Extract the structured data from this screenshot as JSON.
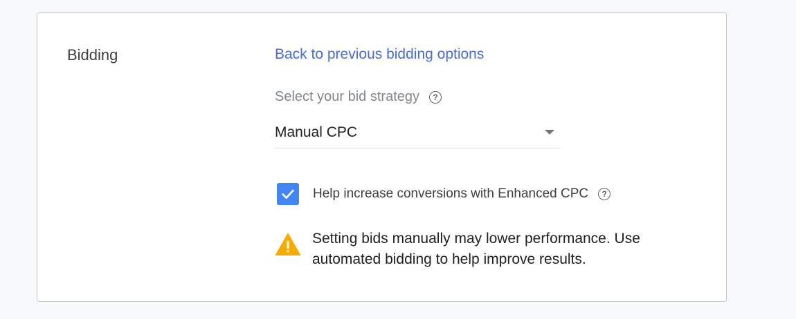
{
  "bidding": {
    "section_label": "Bidding",
    "back_link": "Back to previous bidding options",
    "strategy_label": "Select your bid strategy",
    "strategy_value": "Manual CPC",
    "enhanced_cpc_label": "Help increase conversions with Enhanced CPC",
    "enhanced_cpc_checked": true,
    "warning_text": "Setting bids manually may lower performance. Use automated bidding to help improve results."
  },
  "icons": {
    "help": "help-icon",
    "dropdown": "chevron-down-icon",
    "checkbox": "check-icon",
    "warning": "warning-icon"
  },
  "colors": {
    "link": "#4a6bd6",
    "checkbox": "#4285f4",
    "warning": "#f9ab00"
  }
}
